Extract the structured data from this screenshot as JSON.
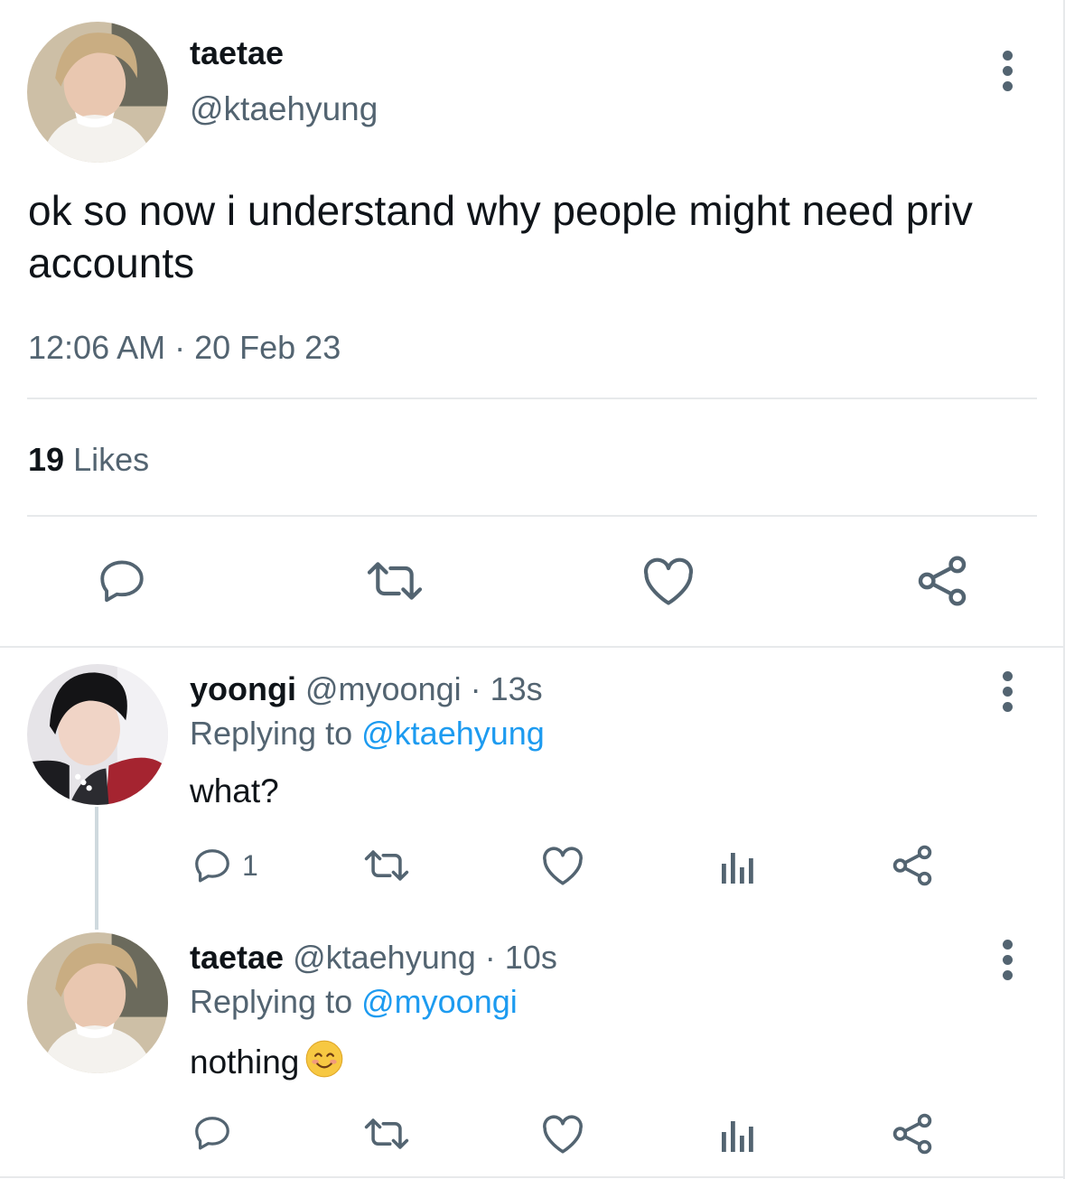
{
  "main_tweet": {
    "display_name": "taetae",
    "handle": "@ktaehyung",
    "text": "ok so now i understand why people might need priv accounts",
    "timestamp": "12:06 AM · 20 Feb 23",
    "likes_count": "19",
    "likes_label": "Likes"
  },
  "replies": [
    {
      "display_name": "yoongi",
      "handle": "@myoongi",
      "time": "· 13s",
      "replying_prefix": "Replying to",
      "replying_to": "@ktaehyung",
      "text": "what?",
      "reply_count": "1"
    },
    {
      "display_name": "taetae",
      "handle": "@ktaehyung",
      "time": "· 10s",
      "replying_prefix": "Replying to",
      "replying_to": "@myoongi",
      "text": "nothing",
      "emoji": "smiling-face-emoji"
    }
  ],
  "colors": {
    "text": "#0f1419",
    "secondary": "#536471",
    "link": "#1d9bf0",
    "divider": "#e7e9eb"
  }
}
